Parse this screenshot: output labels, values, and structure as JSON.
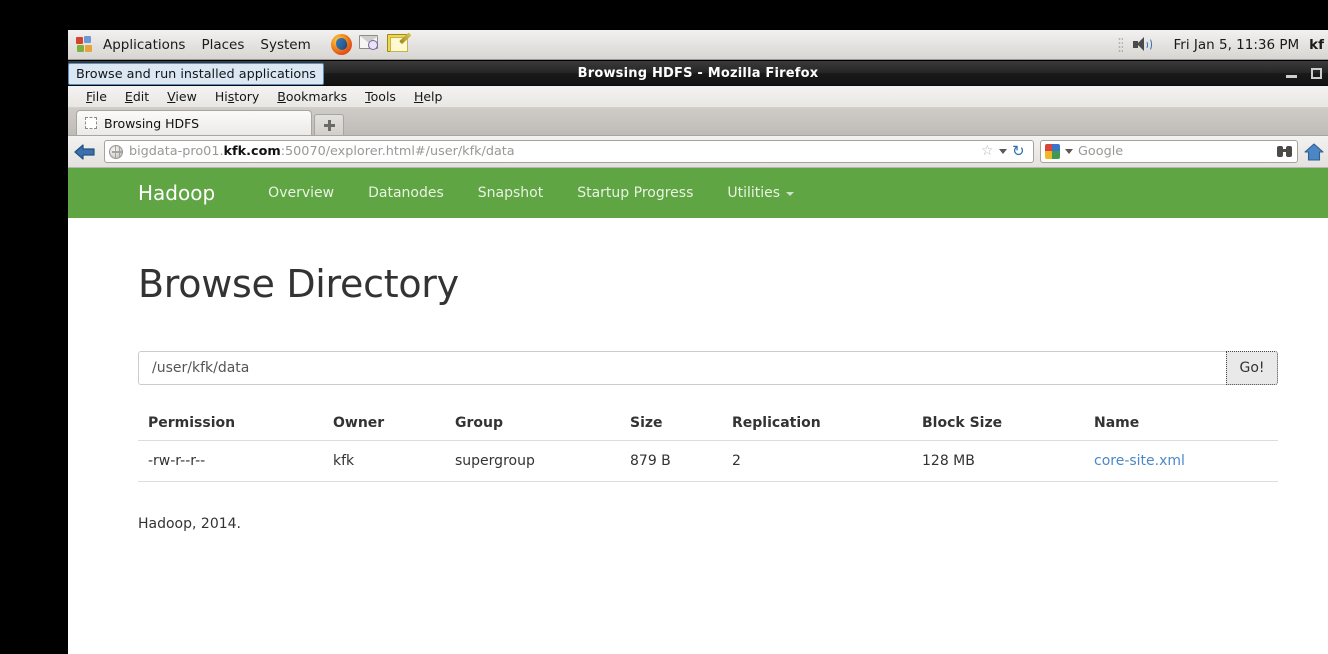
{
  "desktop": {
    "panel": {
      "apps_label": "Applications",
      "places_label": "Places",
      "system_label": "System",
      "launchers": [
        "firefox-icon",
        "evolution-mail-icon",
        "text-editor-icon"
      ],
      "volume_icon": "volume-icon",
      "clock": "Fri Jan  5, 11:36 PM",
      "user": "kf"
    },
    "tooltip": "Browse and run installed applications"
  },
  "browser": {
    "window_title": "Browsing HDFS - Mozilla Firefox",
    "window_buttons": {
      "minimize": "minimize-icon",
      "maximize": "maximize-icon"
    },
    "menubar": [
      "File",
      "Edit",
      "View",
      "History",
      "Bookmarks",
      "Tools",
      "Help"
    ],
    "tab": {
      "title": "Browsing HDFS",
      "new_tab": "+"
    },
    "url": {
      "prefix": "bigdata-pro01.",
      "domain": "kfk.com",
      "suffix": ":50070/explorer.html#/user/kfk/data",
      "full": "bigdata-pro01.kfk.com:50070/explorer.html#/user/kfk/data"
    },
    "search": {
      "engine": "Google",
      "placeholder": "Google"
    }
  },
  "hadoop": {
    "brand": "Hadoop",
    "nav": [
      {
        "label": "Overview"
      },
      {
        "label": "Datanodes"
      },
      {
        "label": "Snapshot"
      },
      {
        "label": "Startup Progress"
      },
      {
        "label": "Utilities",
        "caret": true
      }
    ],
    "accent_color": "#5fa543",
    "page_title": "Browse Directory",
    "path_input": {
      "value": "/user/kfk/data"
    },
    "go_button": "Go!",
    "table": {
      "headers": [
        "Permission",
        "Owner",
        "Group",
        "Size",
        "Replication",
        "Block Size",
        "Name"
      ],
      "rows": [
        {
          "permission": "-rw-r--r--",
          "owner": "kfk",
          "group": "supergroup",
          "size": "879 B",
          "replication": "2",
          "block_size": "128 MB",
          "name": "core-site.xml"
        }
      ]
    },
    "footer": "Hadoop, 2014."
  }
}
